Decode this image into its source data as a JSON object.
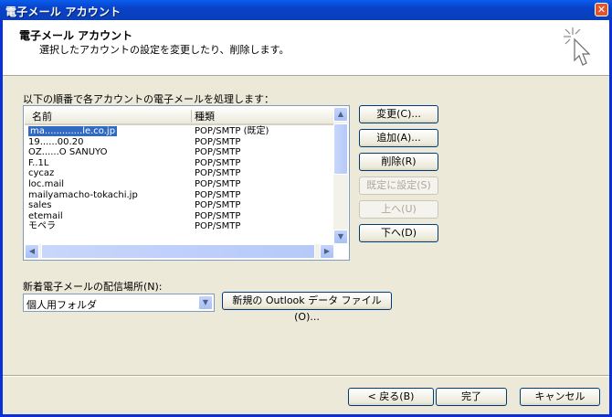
{
  "window": {
    "title": "電子メール アカウント"
  },
  "header": {
    "title": "電子メール アカウント",
    "subtitle": "選択したアカウントの設定を変更したり、削除します。"
  },
  "accounts": {
    "label": "以下の順番で各アカウントの電子メールを処理します：",
    "columns": {
      "name": "名前",
      "type": "種類"
    },
    "rows": [
      {
        "name": "ma.............le.co.jp",
        "type": "POP/SMTP (既定)"
      },
      {
        "name": "19......00.20",
        "type": "POP/SMTP"
      },
      {
        "name": "OZ......O SANUYO",
        "type": "POP/SMTP"
      },
      {
        "name": "F..1L",
        "type": "POP/SMTP"
      },
      {
        "name": "cycaz",
        "type": "POP/SMTP"
      },
      {
        "name": "loc.mail",
        "type": "POP/SMTP"
      },
      {
        "name": "mailyamacho-tokachi.jp",
        "type": "POP/SMTP"
      },
      {
        "name": "sales",
        "type": "POP/SMTP"
      },
      {
        "name": "etemail",
        "type": "POP/SMTP"
      },
      {
        "name": "モペラ",
        "type": "POP/SMTP"
      }
    ]
  },
  "buttons": {
    "change": "変更(C)...",
    "add": "追加(A)...",
    "delete": "削除(R)",
    "set_default": "既定に設定(S)",
    "up": "上へ(U)",
    "down": "下へ(D)"
  },
  "delivery": {
    "label": "新着電子メールの配信場所(N):",
    "selected": "個人用フォルダ",
    "new_file_button": "新規の Outlook データ ファイル(O)..."
  },
  "footer": {
    "back": "< 戻る(B)",
    "finish": "完了",
    "cancel": "キャンセル"
  }
}
